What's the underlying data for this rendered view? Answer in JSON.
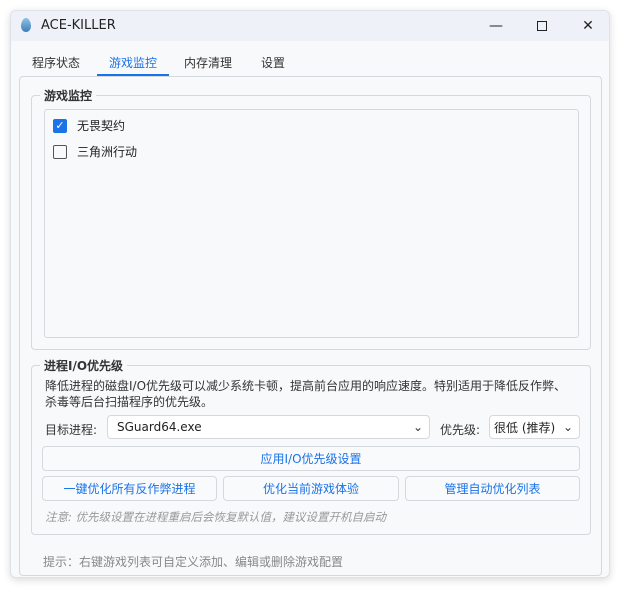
{
  "window": {
    "title": "ACE-KILLER",
    "controls": [
      "minimize",
      "maximize",
      "close"
    ]
  },
  "tabs": [
    {
      "label": "程序状态"
    },
    {
      "label": "游戏监控",
      "active": true
    },
    {
      "label": "内存清理"
    },
    {
      "label": "设置"
    }
  ],
  "game_monitor": {
    "title": "游戏监控",
    "games": [
      {
        "label": "无畏契约",
        "checked": true
      },
      {
        "label": "三角洲行动",
        "checked": false
      }
    ]
  },
  "io_priority": {
    "title": "进程I/O优先级",
    "description": "降低进程的磁盘I/O优先级可以减少系统卡顿，提高前台应用的响应速度。特别适用于降低反作弊、杀毒等后台扫描程序的优先级。",
    "target_label": "目标进程:",
    "target_value": "SGuard64.exe",
    "priority_label": "优先级:",
    "priority_value": "很低 (推荐)",
    "apply_button": "应用I/O优先级设置",
    "optimize_all_button": "一键优化所有反作弊进程",
    "optimize_game_button": "优化当前游戏体验",
    "manage_list_button": "管理自动优化列表",
    "note": "注意: 优先级设置在进程重启后会恢复默认值，建议设置开机自启动"
  },
  "tip": "提示：右键游戏列表可自定义添加、编辑或删除游戏配置",
  "colors": {
    "accent": "#1a73e8"
  }
}
